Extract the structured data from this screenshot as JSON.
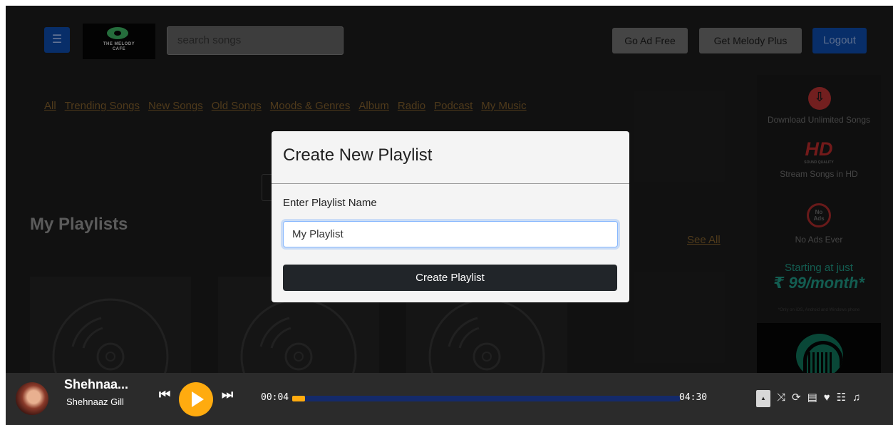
{
  "header": {
    "menu_icon": "☰",
    "logo_text": "THE MELODY\nCAFE",
    "search_placeholder": "search songs",
    "go_ad_free": "Go Ad Free",
    "get_melody_plus": "Get Melody Plus",
    "logout": "Logout"
  },
  "nav": {
    "items": [
      "All",
      "Trending Songs",
      "New Songs",
      "Old Songs",
      "Moods & Genres",
      "Album",
      "Radio",
      "Podcast",
      "My Music"
    ]
  },
  "playlists": {
    "title": "My Playlists",
    "see_all": "See All"
  },
  "promo": {
    "download": "Download Unlimited Songs",
    "hd_logo": "HD",
    "hd_sub": "SOUND QUALITY",
    "hd_text": "Stream Songs in HD",
    "noads_badge": "No\nAds",
    "noads_text": "No Ads Ever",
    "starting": "Starting at just",
    "price": "₹ 99/month*",
    "fine": "*Only on iOS, Android and Windows phone"
  },
  "modal": {
    "title": "Create New Playlist",
    "label": "Enter Playlist Name",
    "input_value": "My Playlist",
    "button": "Create Playlist"
  },
  "player": {
    "song_title": "Shehnaa...",
    "artist": "Shehnaaz Gill",
    "current_time": "00:04",
    "total_time": "04:30",
    "progress_fraction": 0.033,
    "prev_icon": "⏮",
    "next_icon": "⏭",
    "expand_icon": "▲",
    "right_icons": [
      "shuffle-icon",
      "repeat-icon",
      "lyrics-icon",
      "heart-icon",
      "queue-icon",
      "playlist-icon"
    ],
    "right_glyphs": [
      "⤨",
      "⟳",
      "▤",
      "♥",
      "☷",
      "♫"
    ]
  },
  "colors": {
    "accent": "#ffab0f",
    "primary": "#0d47a1",
    "background": "#1b1b1b"
  }
}
